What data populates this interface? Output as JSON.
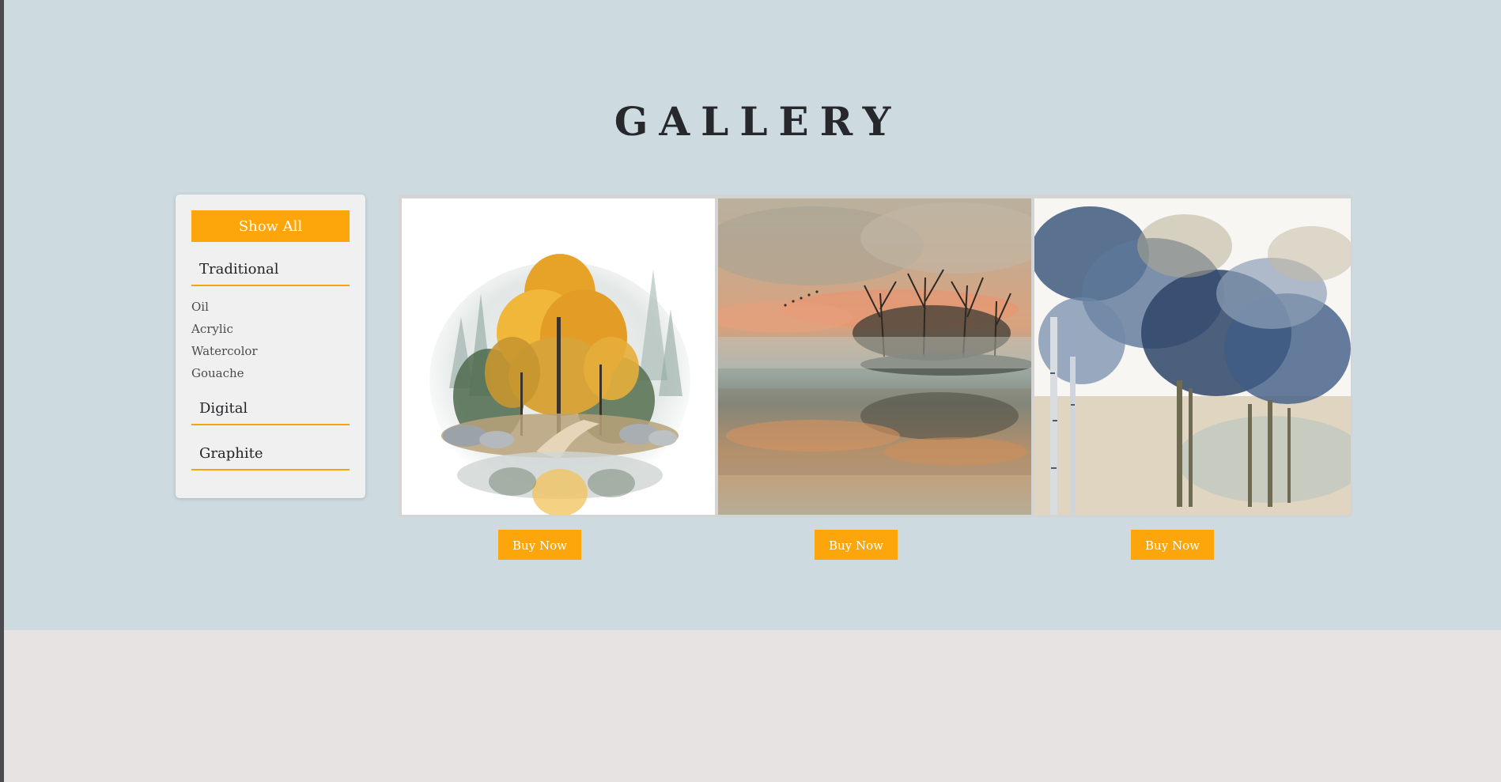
{
  "page": {
    "title": "GALLERY"
  },
  "sidebar": {
    "show_all_label": "Show All",
    "categories": [
      {
        "label": "Traditional",
        "items": [
          "Oil",
          "Acrylic",
          "Watercolor",
          "Gouache"
        ]
      },
      {
        "label": "Digital"
      },
      {
        "label": "Graphite"
      }
    ]
  },
  "gallery": {
    "artworks": [
      {
        "image": "watercolor-autumn-forest-island",
        "buy_label": "Buy Now"
      },
      {
        "image": "watercolor-misty-lake-sunset-trees",
        "buy_label": "Buy Now"
      },
      {
        "image": "watercolor-blue-trees",
        "buy_label": "Buy Now"
      }
    ]
  },
  "colors": {
    "hero_background": "#cddbe0",
    "footer_background": "#e6e3e2",
    "accent": "#fca60c",
    "title_text": "#26282c"
  }
}
